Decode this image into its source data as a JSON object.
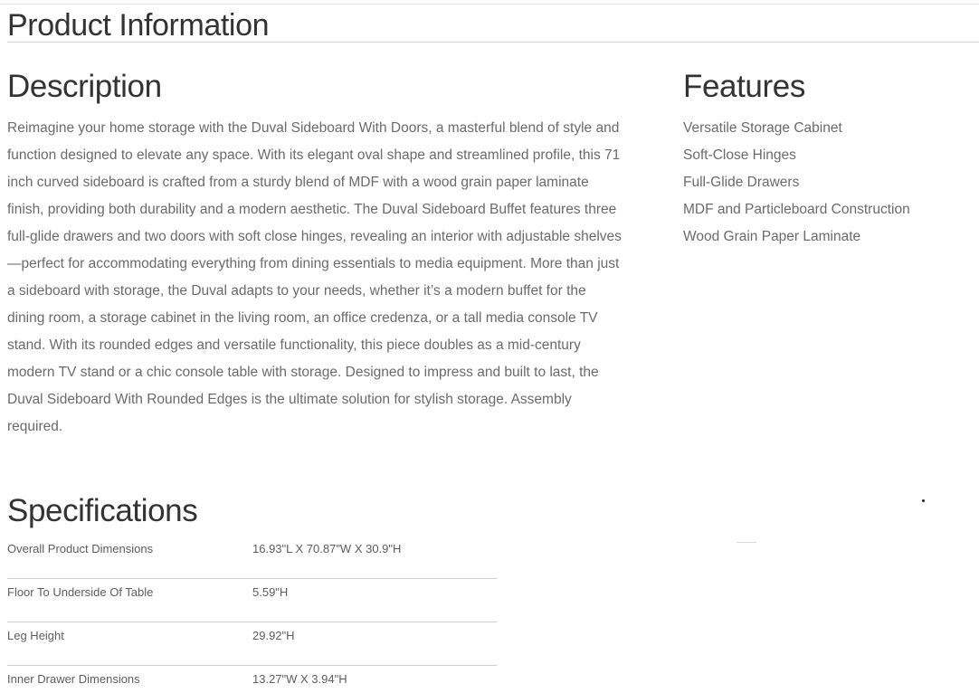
{
  "page": {
    "title": "Product Information"
  },
  "description": {
    "heading": "Description",
    "text": "Reimagine your home storage with the Duval Sideboard With Doors, a masterful blend of style and function designed to elevate any space. With its elegant oval shape and streamlined profile, this 71 inch curved sideboard is crafted from a sturdy blend of MDF with a wood grain paper laminate finish, providing both durability and a modern aesthetic. The Duval Sideboard Buffet features three full-glide drawers and two doors with soft close hinges, revealing an interior with adjustable shelves—perfect for accommodating everything from dining essentials to media equipment. More than just a sideboard with storage, the Duval adapts to your needs, whether it’s a modern buffet for the dining room, a storage cabinet in the living room, an office credenza, or a tall media console TV stand. With its rounded edges and versatile functionality, this piece doubles as a mid-century modern TV stand or a chic console table with storage. Designed to impress and built to last, the Duval Sideboard With Rounded Edges is the ultimate solution for stylish storage. Assembly required."
  },
  "features": {
    "heading": "Features",
    "items": [
      "Versatile Storage Cabinet",
      "Soft-Close Hinges",
      "Full-Glide Drawers",
      "MDF and Particleboard Construction",
      "Wood Grain Paper Laminate"
    ]
  },
  "specifications": {
    "heading": "Specifications",
    "rows": [
      {
        "label": "Overall Product Dimensions",
        "value": "16.93\"L X 70.87\"W X 30.9\"H"
      },
      {
        "label": "Floor To Underside Of Table",
        "value": "5.59\"H"
      },
      {
        "label": "Leg Height",
        "value": "29.92\"H"
      },
      {
        "label": "Inner Drawer Dimensions",
        "value": "13.27\"W X 3.94\"H"
      }
    ]
  }
}
